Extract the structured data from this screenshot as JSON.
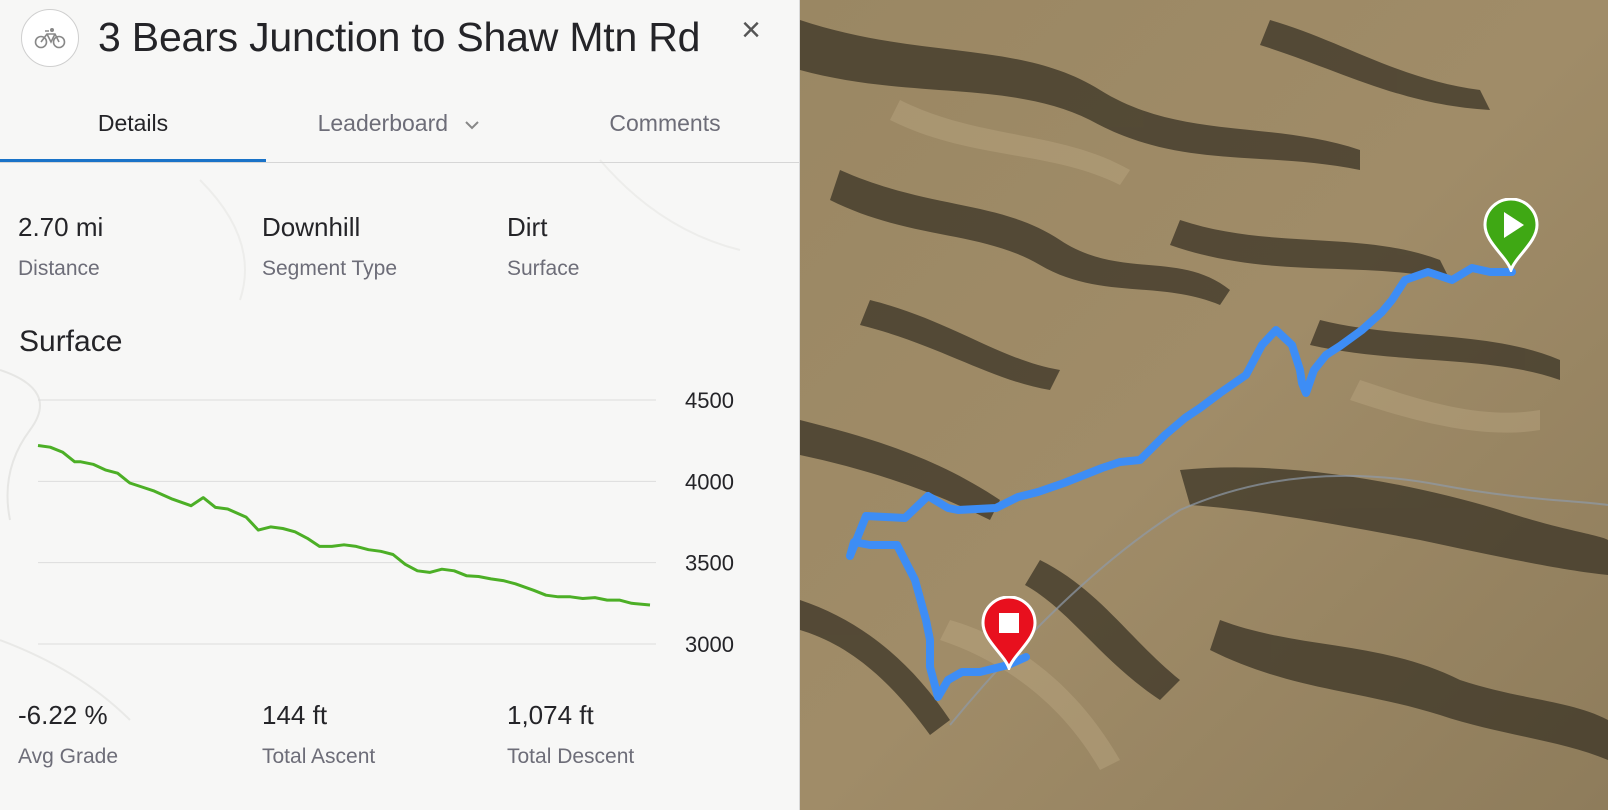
{
  "header": {
    "title": "3 Bears Junction to Shaw Mtn Rd",
    "sport_icon": "bike-icon",
    "close_label": "×"
  },
  "tabs": [
    {
      "label": "Details",
      "active": true
    },
    {
      "label": "Leaderboard",
      "icon": "chevron-down-icon",
      "active": false
    },
    {
      "label": "Comments",
      "active": false
    }
  ],
  "stats_top": [
    {
      "value": "2.70 mi",
      "label": "Distance"
    },
    {
      "value": "Downhill",
      "label": "Segment Type"
    },
    {
      "value": "Dirt",
      "label": "Surface"
    }
  ],
  "section_title": "Surface",
  "chart_data": {
    "type": "line",
    "title": "",
    "xlabel": "",
    "ylabel": "",
    "ylim": [
      2800,
      4550
    ],
    "yticks": [
      "4500",
      "4000",
      "3500",
      "3000"
    ],
    "grid": true,
    "series": [
      {
        "color": "#4caf26",
        "x": [
          0.0,
          0.02,
          0.04,
          0.06,
          0.07,
          0.09,
          0.11,
          0.13,
          0.15,
          0.17,
          0.19,
          0.22,
          0.25,
          0.27,
          0.29,
          0.31,
          0.34,
          0.36,
          0.38,
          0.4,
          0.42,
          0.44,
          0.46,
          0.48,
          0.5,
          0.52,
          0.54,
          0.56,
          0.58,
          0.6,
          0.62,
          0.64,
          0.66,
          0.68,
          0.7,
          0.72,
          0.74,
          0.76,
          0.78,
          0.81,
          0.83,
          0.85,
          0.87,
          0.89,
          0.91,
          0.93,
          0.95,
          0.97,
          1.0
        ],
        "values": [
          4220,
          4210,
          4180,
          4120,
          4120,
          4105,
          4070,
          4050,
          3990,
          3965,
          3940,
          3890,
          3850,
          3900,
          3840,
          3830,
          3780,
          3700,
          3720,
          3710,
          3690,
          3650,
          3600,
          3600,
          3610,
          3600,
          3580,
          3570,
          3550,
          3490,
          3450,
          3440,
          3460,
          3450,
          3420,
          3415,
          3400,
          3390,
          3370,
          3330,
          3300,
          3290,
          3290,
          3280,
          3285,
          3270,
          3270,
          3250,
          3240
        ]
      }
    ]
  },
  "stats_bottom": [
    {
      "value": "-6.22 %",
      "label": "Avg Grade"
    },
    {
      "value": "144 ft",
      "label": "Total Ascent"
    },
    {
      "value": "1,074 ft",
      "label": "Total Descent"
    }
  ],
  "map": {
    "route_color": "#3d8df5",
    "start_marker": {
      "icon": "play-icon",
      "color": "#3fa814"
    },
    "end_marker": {
      "icon": "stop-icon",
      "color": "#e8101e"
    }
  }
}
